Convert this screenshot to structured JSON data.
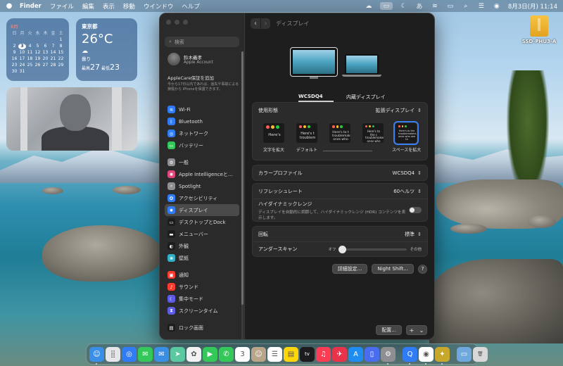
{
  "menubar": {
    "app_name": "Finder",
    "menus": [
      "ファイル",
      "編集",
      "表示",
      "移動",
      "ウインドウ",
      "ヘルプ"
    ],
    "input_method": "あ",
    "datetime": "8月3日(月)  11:14"
  },
  "widgets": {
    "calendar": {
      "month": "8月",
      "weekdays": [
        "日",
        "月",
        "火",
        "水",
        "木",
        "金",
        "土"
      ],
      "weeks": [
        [
          "",
          "",
          "",
          "",
          "",
          "",
          "1"
        ],
        [
          "2",
          "3",
          "4",
          "5",
          "6",
          "7",
          "8"
        ],
        [
          "9",
          "10",
          "11",
          "12",
          "13",
          "14",
          "15"
        ],
        [
          "16",
          "17",
          "18",
          "19",
          "20",
          "21",
          "22"
        ],
        [
          "23",
          "24",
          "25",
          "26",
          "27",
          "28",
          "29"
        ],
        [
          "30",
          "31",
          "",
          "",
          "",
          "",
          ""
        ]
      ],
      "today": "3"
    },
    "weather": {
      "city": "東京都",
      "temperature": "26°C",
      "condition": "曇り",
      "high_label": "最高",
      "high": "27",
      "low_label": "最低",
      "low": "23"
    }
  },
  "desktop": {
    "drive_label": "SSD-PHU3-A"
  },
  "settings": {
    "search_placeholder": "検索",
    "account": {
      "name": "鈴木義孝",
      "subtitle": "Apple Account"
    },
    "applecare": {
      "title": "AppleCare保証を追加",
      "description": "今から17日以内であれば、過失や事故による損傷から iPhoneを保護できます。"
    },
    "sidebar_groups": [
      [
        {
          "label": "Wi-Fi",
          "icon": "wifi-icon",
          "color": "#2f7cf6",
          "glyph": "≋"
        },
        {
          "label": "Bluetooth",
          "icon": "bluetooth-icon",
          "color": "#2f7cf6",
          "glyph": "ᛒ"
        },
        {
          "label": "ネットワーク",
          "icon": "network-icon",
          "color": "#2f7cf6",
          "glyph": "◎"
        },
        {
          "label": "バッテリー",
          "icon": "battery-icon",
          "color": "#34c759",
          "glyph": "▭"
        }
      ],
      [
        {
          "label": "一般",
          "icon": "general-gear-icon",
          "color": "#8e8e93",
          "glyph": "⚙"
        },
        {
          "label": "Apple Intelligenceと…",
          "icon": "apple-intelligence-icon",
          "color": "#e0457b",
          "glyph": "✺"
        },
        {
          "label": "Spotlight",
          "icon": "spotlight-icon",
          "color": "#8e8e93",
          "glyph": "⌕"
        },
        {
          "label": "アクセシビリティ",
          "icon": "accessibility-icon",
          "color": "#2f7cf6",
          "glyph": "✪"
        },
        {
          "label": "ディスプレイ",
          "icon": "display-icon",
          "color": "#2f7cf6",
          "glyph": "✹",
          "selected": true
        },
        {
          "label": "デスクトップとDock",
          "icon": "desktop-dock-icon",
          "color": "#1c1c1e",
          "glyph": "▭"
        },
        {
          "label": "メニューバー",
          "icon": "menu-bar-icon",
          "color": "#1c1c1e",
          "glyph": "▬"
        },
        {
          "label": "外観",
          "icon": "appearance-icon",
          "color": "#1c1c1e",
          "glyph": "◐"
        },
        {
          "label": "壁紙",
          "icon": "wallpaper-icon",
          "color": "#30b0c7",
          "glyph": "❀"
        }
      ],
      [
        {
          "label": "通知",
          "icon": "notifications-icon",
          "color": "#ff3b30",
          "glyph": "▣"
        },
        {
          "label": "サウンド",
          "icon": "sound-icon",
          "color": "#ff3b30",
          "glyph": "♪"
        },
        {
          "label": "集中モード",
          "icon": "focus-icon",
          "color": "#5e5ce6",
          "glyph": "☾"
        },
        {
          "label": "スクリーンタイム",
          "icon": "screen-time-icon",
          "color": "#5e5ce6",
          "glyph": "⧗"
        }
      ],
      [
        {
          "label": "ロック画面",
          "icon": "lock-screen-icon",
          "color": "#1c1c1e",
          "glyph": "▤"
        }
      ]
    ],
    "page_title": "ディスプレイ",
    "displays": [
      {
        "label": "WCSDQ4",
        "selected": true
      },
      {
        "label": "内蔵ディスプレイ",
        "selected": false
      }
    ],
    "usage": {
      "label": "使用形態",
      "value": "拡張ディスプレイ"
    },
    "resolution_modes": [
      {
        "caption": "文字を拡大",
        "sample": "Here's",
        "selected": false
      },
      {
        "caption": "デフォルト",
        "sample": "Here's t troublem",
        "selected": false
      },
      {
        "caption": "",
        "sample": "Here's to t troublemake ones who",
        "selected": false
      },
      {
        "caption": "",
        "sample": "Here's to the c troublemakers. ones who see",
        "selected": false
      },
      {
        "caption": "スペースを拡大",
        "sample": "Here's to the troublemakers. ones who see th",
        "selected": true
      }
    ],
    "color_profile": {
      "label": "カラープロファイル",
      "value": "WCSDQ4"
    },
    "refresh_rate": {
      "label": "リフレッシュレート",
      "value": "60ヘルツ"
    },
    "hdr": {
      "label": "ハイダイナミックレンジ",
      "description": "ディスプレイを自動的に調節して、ハイダイナミックレンジ (HDR) コンテンツを表示します。",
      "enabled": false
    },
    "rotation": {
      "label": "回転",
      "value": "標準"
    },
    "underscan": {
      "label": "アンダースキャン",
      "min_label": "オフ",
      "max_label": "その他",
      "value": 0
    },
    "advanced_button": "詳細設定...",
    "night_shift_button": "Night Shift...",
    "help_button": "?",
    "arrange_button": "配置...",
    "add_button": "+",
    "add_menu_chevron": "⌄"
  },
  "dock": [
    {
      "name": "finder-icon",
      "color": "#3a8ee6",
      "glyph": "☺",
      "run": true
    },
    {
      "name": "launchpad-icon",
      "color": "#e5e5ea",
      "glyph": "⣿"
    },
    {
      "name": "safari-icon",
      "color": "#2f7cf6",
      "glyph": "◎"
    },
    {
      "name": "messages-icon",
      "color": "#34c759",
      "glyph": "✉"
    },
    {
      "name": "mail-icon",
      "color": "#3a8ee6",
      "glyph": "✉"
    },
    {
      "name": "maps-icon",
      "color": "#5ac8a0",
      "glyph": "➤"
    },
    {
      "name": "photos-icon",
      "color": "#f2f2f2",
      "glyph": "✿"
    },
    {
      "name": "facetime-icon",
      "color": "#34c759",
      "glyph": "▶"
    },
    {
      "name": "phone-icon",
      "color": "#34c759",
      "glyph": "✆"
    },
    {
      "name": "calendar-icon",
      "color": "#ffffff",
      "glyph": "3"
    },
    {
      "name": "contacts-icon",
      "color": "#b8a58a",
      "glyph": "☺"
    },
    {
      "name": "reminders-icon",
      "color": "#ffffff",
      "glyph": "☰"
    },
    {
      "name": "notes-icon",
      "color": "#ffd60a",
      "glyph": "▤"
    },
    {
      "name": "apple-tv-icon",
      "color": "#1c1c1e",
      "glyph": "tv"
    },
    {
      "name": "music-icon",
      "color": "#fa3c55",
      "glyph": "♫"
    },
    {
      "name": "podcasts-news-icon",
      "color": "#e8334a",
      "glyph": "✈"
    },
    {
      "name": "app-store-icon",
      "color": "#1e8cf0",
      "glyph": "A"
    },
    {
      "name": "iphone-mirroring-icon",
      "color": "#4a6cf0",
      "glyph": "▯"
    },
    {
      "name": "system-settings-icon",
      "color": "#8e8e93",
      "glyph": "⚙",
      "run": true
    },
    {
      "sep": true
    },
    {
      "name": "quicktime-icon",
      "color": "#2f7cf6",
      "glyph": "Q",
      "run": true
    },
    {
      "name": "chrome-icon",
      "color": "#ffffff",
      "glyph": "◉",
      "run": true
    },
    {
      "name": "app-icon",
      "color": "#c8a82a",
      "glyph": "✦",
      "run": true
    },
    {
      "sep": true
    },
    {
      "name": "downloads-folder-icon",
      "color": "#6fa8dc",
      "glyph": "▭"
    },
    {
      "name": "trash-icon",
      "color": "#d8d8d8",
      "glyph": "🗑"
    }
  ]
}
